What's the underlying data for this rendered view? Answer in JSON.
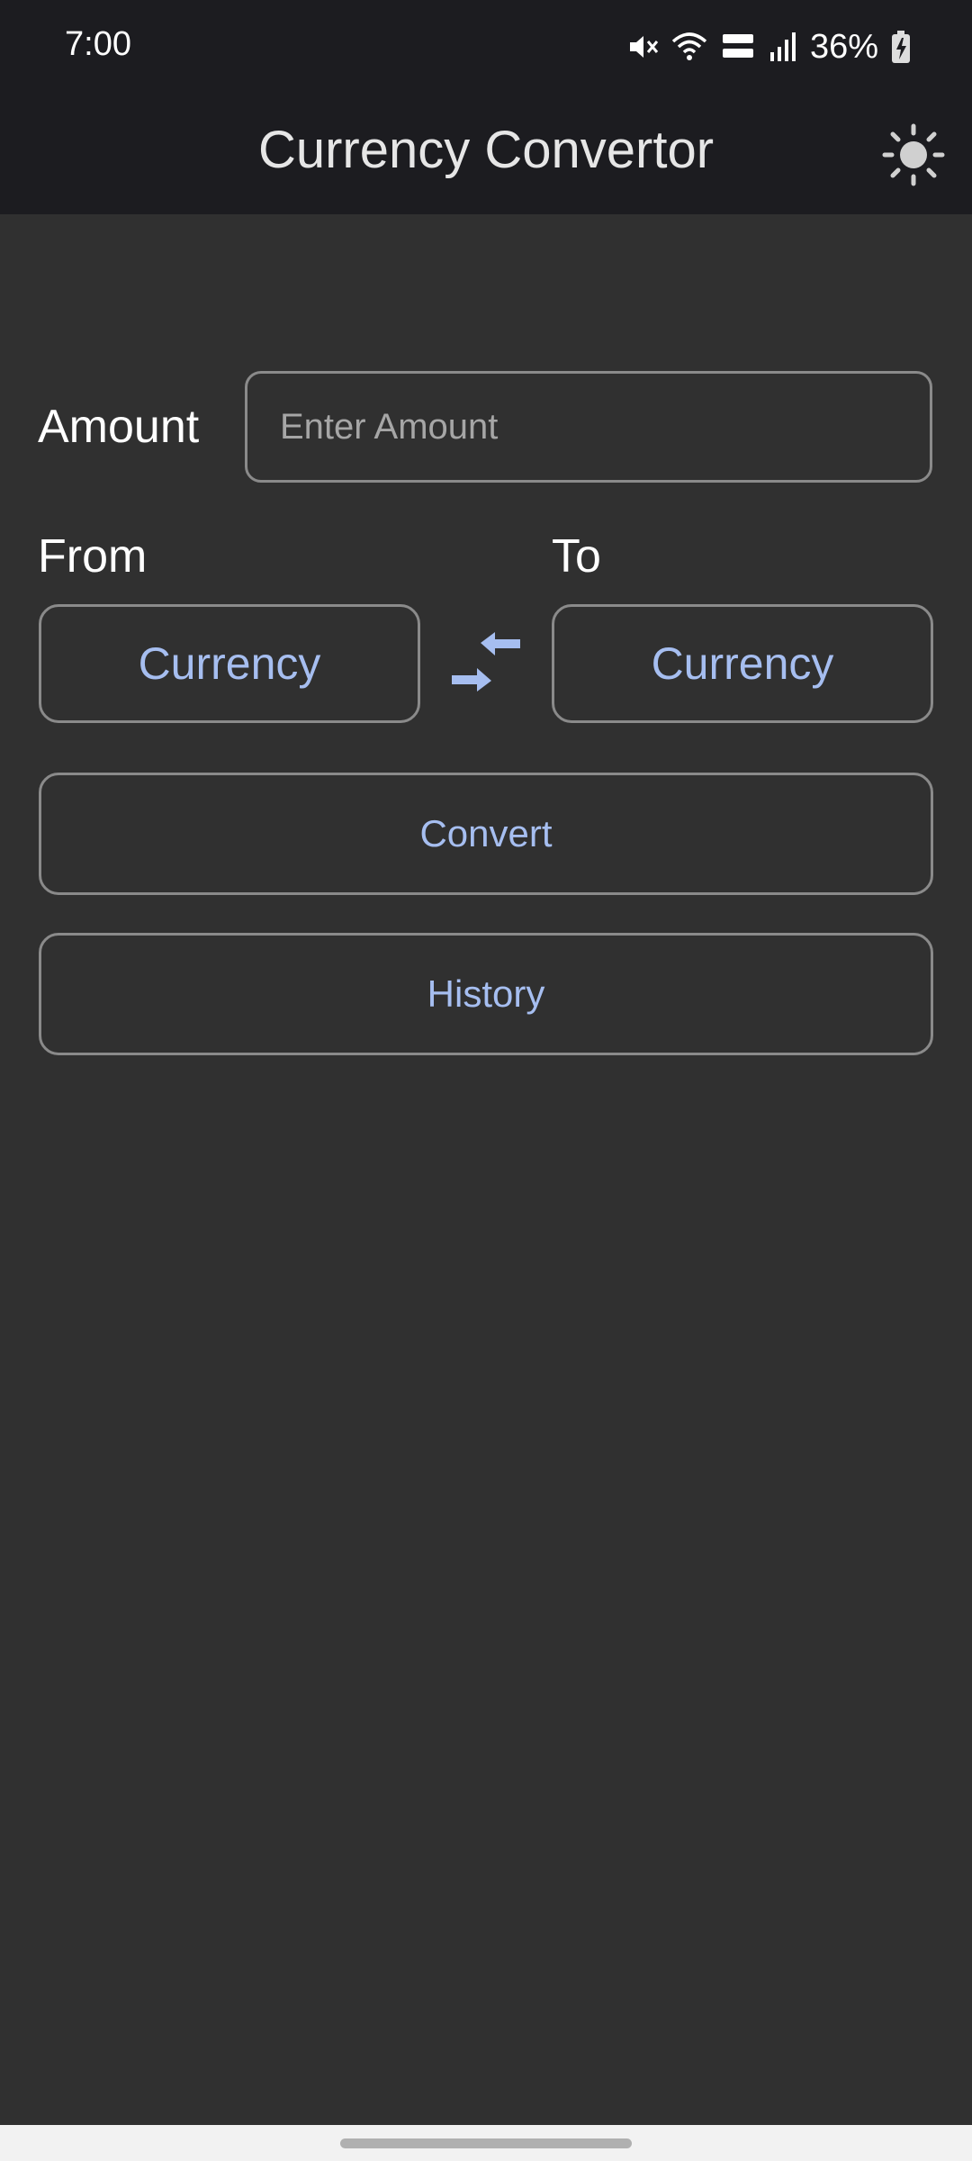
{
  "status_bar": {
    "time": "7:00",
    "battery": "36%",
    "icons": [
      "mute-icon",
      "wifi-icon",
      "volte-icon",
      "signal-icon",
      "battery-charging-icon"
    ]
  },
  "app_bar": {
    "title": "Currency Convertor",
    "theme_icon": "sun-icon"
  },
  "form": {
    "amount_label": "Amount",
    "amount_placeholder": "Enter Amount",
    "amount_value": "",
    "from_label": "From",
    "to_label": "To",
    "from_currency": "Currency",
    "to_currency": "Currency",
    "swap_icon": "swap-arrows-icon",
    "convert_label": "Convert",
    "history_label": "History"
  },
  "colors": {
    "background": "#303030",
    "app_bar": "#1c1c20",
    "accent_text": "#a6bef0",
    "outline": "#8a8a8a"
  }
}
